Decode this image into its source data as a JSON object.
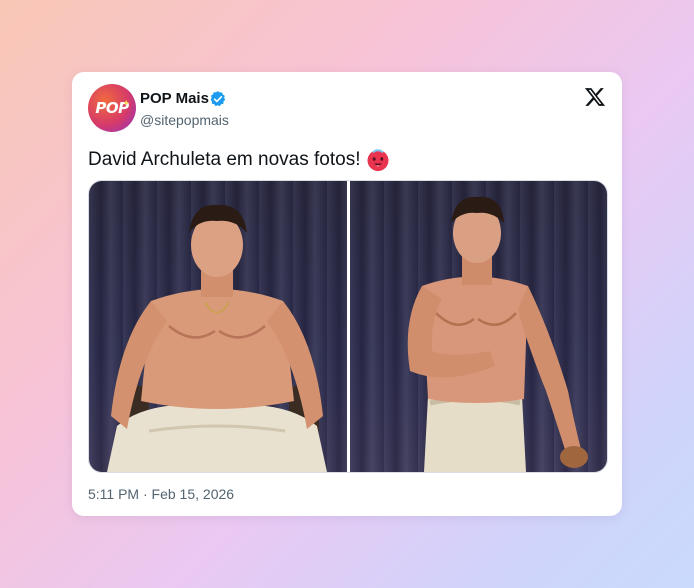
{
  "account": {
    "name": "POP Mais",
    "handle": "@sitepopmais",
    "avatar_text": "POP",
    "verified_icon": "verified-badge-icon",
    "verified_color": "#1d9bf0"
  },
  "tweet": {
    "text": "David Archuleta em novas fotos!",
    "emoji": "hot-face-emoji",
    "timestamp": "5:11 PM · Feb 15, 2026"
  },
  "media": {
    "count": 2,
    "photos": [
      "photo-seated",
      "photo-standing"
    ]
  },
  "platform_icon": "x-logo-icon",
  "colors": {
    "text_primary": "#0f1419",
    "text_secondary": "#536471",
    "avatar_gradient": [
      "#f06a3c",
      "#d63a6a",
      "#8a36c9"
    ]
  }
}
